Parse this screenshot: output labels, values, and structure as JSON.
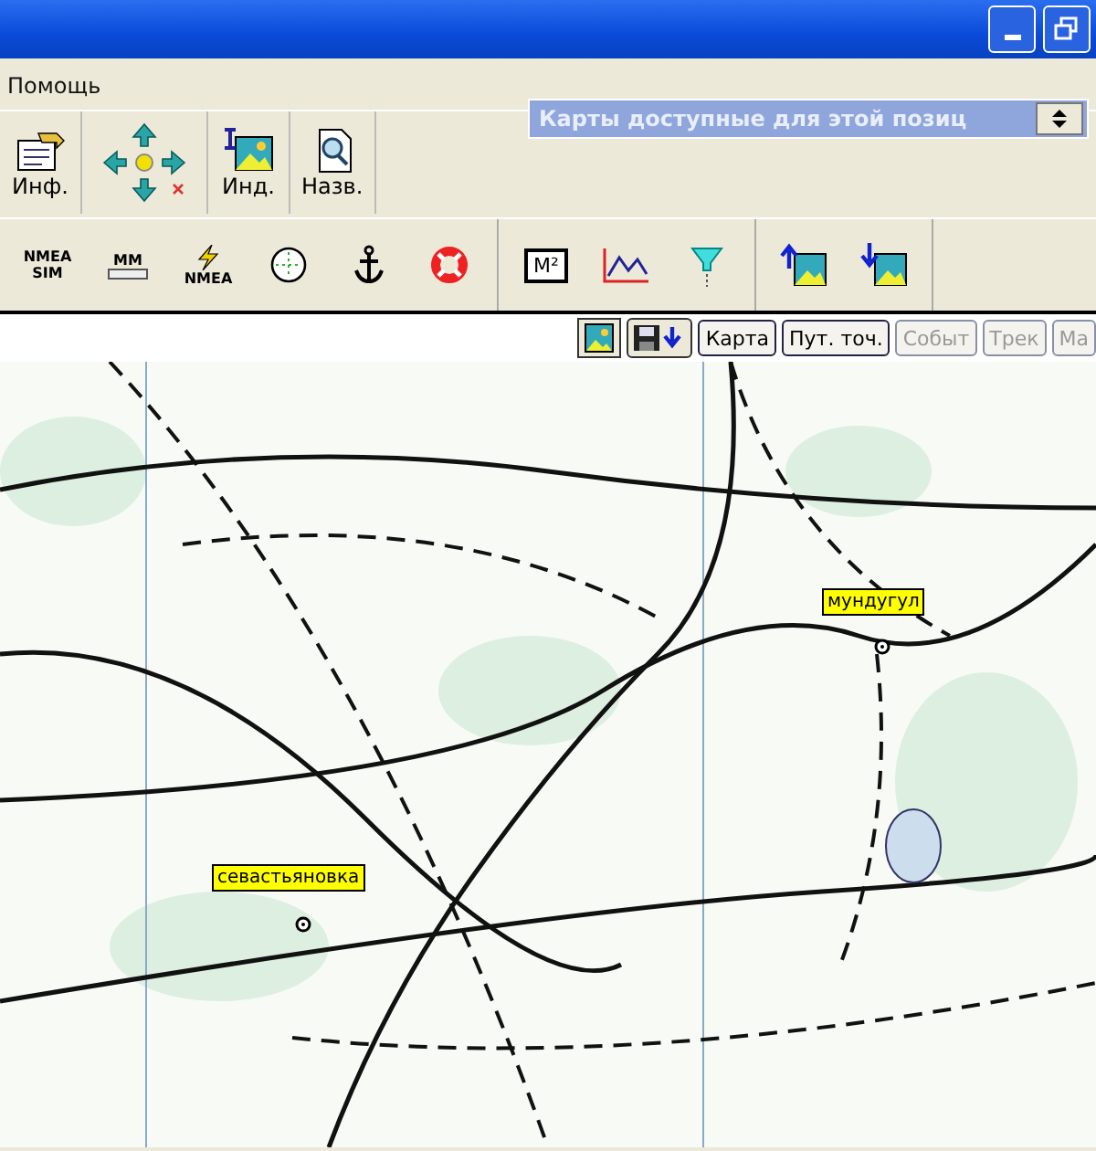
{
  "menu": [
    {
      "label": "Помощь"
    }
  ],
  "map_selector": {
    "value": "Карты доступные для этой позиц"
  },
  "main_tools": [
    {
      "kind": "info",
      "label": "Инф."
    },
    {
      "kind": "pan"
    },
    {
      "kind": "index",
      "label": "Инд."
    },
    {
      "kind": "names",
      "label": "Назв."
    }
  ],
  "tool_groups": [
    [
      {
        "kind": "nmea-sim",
        "lines": [
          "NMEA",
          "SIM"
        ]
      },
      {
        "kind": "mm",
        "lines": [
          "MM"
        ]
      },
      {
        "kind": "nmea",
        "lines": [
          "NMEA"
        ]
      },
      {
        "kind": "target"
      },
      {
        "kind": "anchor"
      },
      {
        "kind": "lifebuoy"
      }
    ],
    [
      {
        "kind": "area",
        "lines": [
          "M²"
        ]
      },
      {
        "kind": "graph"
      },
      {
        "kind": "filter"
      }
    ],
    [
      {
        "kind": "upload"
      },
      {
        "kind": "download"
      }
    ]
  ],
  "map_buttons": [
    {
      "kind": "image"
    },
    {
      "kind": "save"
    },
    {
      "kind": "text",
      "label": "Карта",
      "disabled": false
    },
    {
      "kind": "text",
      "label": "Пут. точ.",
      "disabled": false
    },
    {
      "kind": "text",
      "label": "Событ",
      "disabled": true
    },
    {
      "kind": "text",
      "label": "Трек",
      "disabled": true
    },
    {
      "kind": "text",
      "label": "Ма",
      "disabled": true
    }
  ],
  "map": {
    "markers": [
      {
        "label": "мундугул"
      },
      {
        "label": "севастьяновка"
      }
    ]
  }
}
